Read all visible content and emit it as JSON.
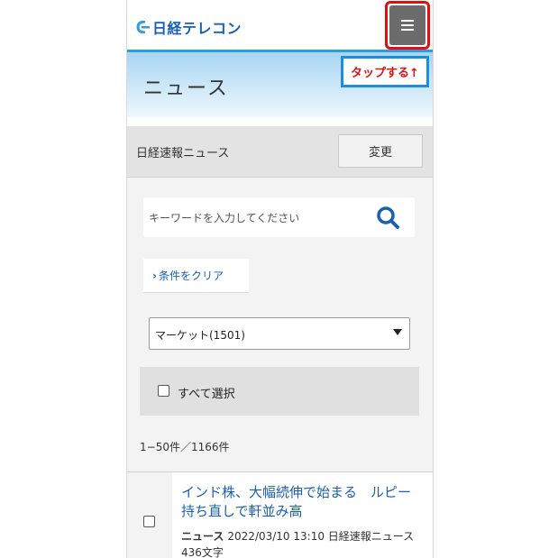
{
  "header": {
    "logo_text": "日経テレコン",
    "menu_icon": "hamburger-icon",
    "tip_text": "タップする↑"
  },
  "banner": {
    "title": "ニュース"
  },
  "section": {
    "label": "日経速報ニュース",
    "change_button": "変更"
  },
  "search": {
    "placeholder": "キーワードを入力してください",
    "icon": "search-icon"
  },
  "filters": {
    "clear_chevron": "›",
    "clear_label": "条件をクリア",
    "category_selected": "マーケット(1501)",
    "select_all_label": "すべて選択"
  },
  "results": {
    "count": "1−50件／1166件"
  },
  "articles": [
    {
      "title": "インド株、大幅続伸で始まる　ルピー持ち直しで軒並み高",
      "source": "ニュース",
      "meta": "2022/03/10 13:10 日経速報ニュース　436文字"
    }
  ],
  "colors": {
    "accent": "#2f9cdc",
    "link": "#1a5fb4",
    "highlight": "#e01010"
  }
}
